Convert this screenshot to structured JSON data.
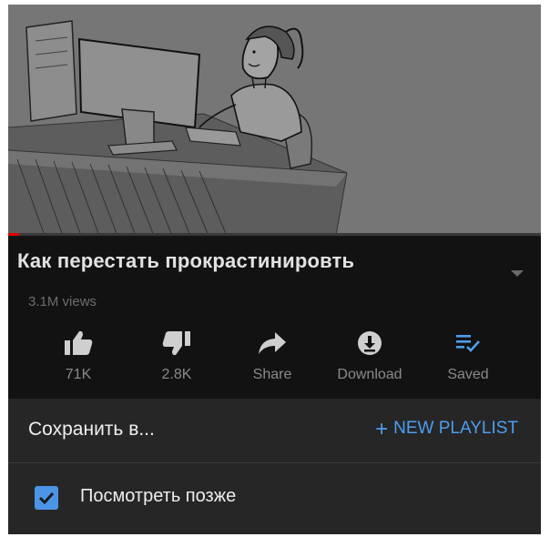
{
  "video": {
    "title": "Как перестать прокрастинировть",
    "views": "3.1M views",
    "progress_fraction": 0.02
  },
  "actions": [
    {
      "label": "71K",
      "icon": "thumbs-up-icon"
    },
    {
      "label": "2.8K",
      "icon": "thumbs-down-icon"
    },
    {
      "label": "Share",
      "icon": "share-icon"
    },
    {
      "label": "Download",
      "icon": "download-icon"
    },
    {
      "label": "Saved",
      "icon": "playlist-saved-icon"
    }
  ],
  "save_sheet": {
    "title": "Сохранить в...",
    "new_playlist_label": "NEW PLAYLIST",
    "playlists": [
      {
        "label": "Посмотреть позже",
        "checked": true
      }
    ]
  },
  "colors": {
    "accent": "#4d9ef0",
    "checkbox": "#4c95e6",
    "progress": "#e00000"
  }
}
